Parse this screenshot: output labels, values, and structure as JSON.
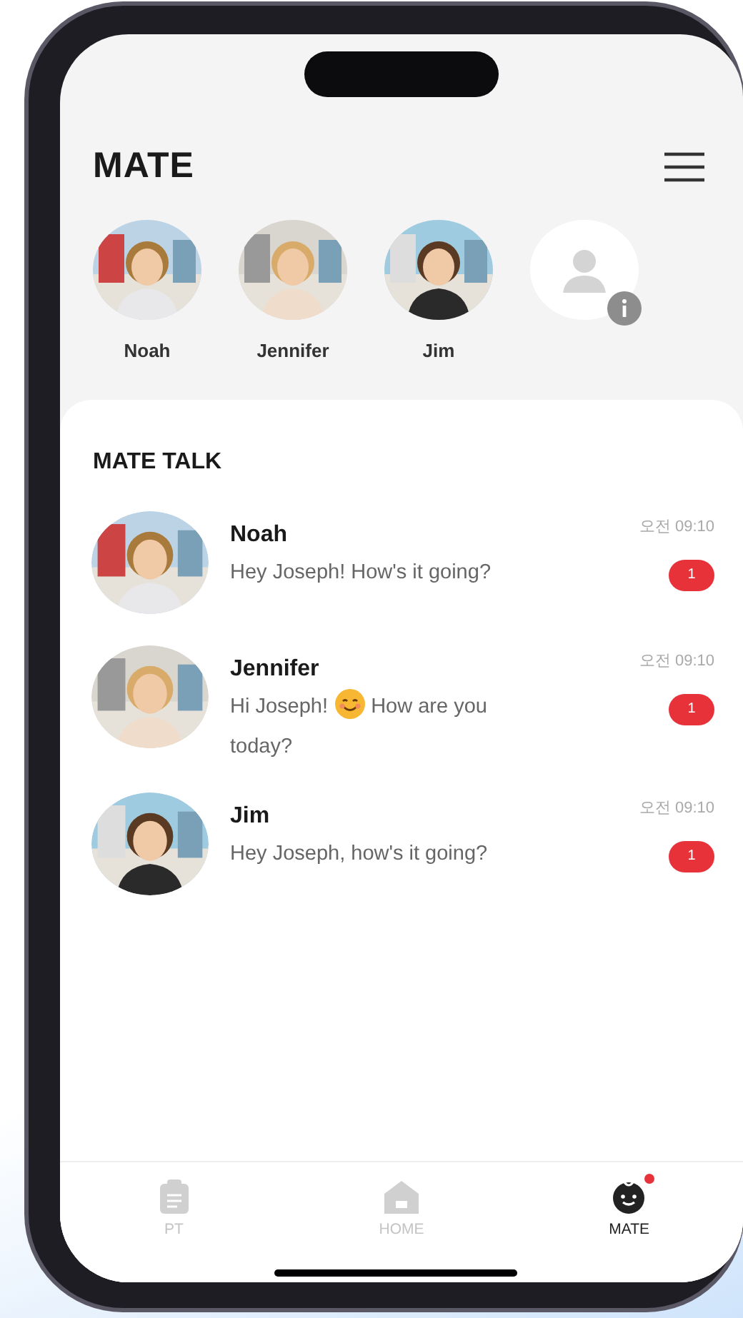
{
  "header": {
    "title": "MATE"
  },
  "mates": [
    {
      "name": "Noah"
    },
    {
      "name": "Jennifer"
    },
    {
      "name": "Jim"
    },
    {
      "kind": "placeholder"
    }
  ],
  "talk": {
    "title": "MATE TALK",
    "chats": [
      {
        "name": "Noah",
        "time": "오전 09:10",
        "unread": "1",
        "message": [
          {
            "kind": "text",
            "text": "Hey Joseph! How's it going?"
          }
        ]
      },
      {
        "name": "Jennifer",
        "time": "오전 09:10",
        "unread": "1",
        "message": [
          {
            "kind": "text",
            "text": "Hi Joseph!"
          },
          {
            "kind": "emoji"
          },
          {
            "kind": "text",
            "text": "How are you"
          },
          {
            "kind": "text",
            "text": "today?"
          }
        ]
      },
      {
        "name": "Jim",
        "time": "오전 09:10",
        "unread": "1",
        "message": [
          {
            "kind": "text",
            "text": "Hey Joseph, how's it going?"
          }
        ]
      }
    ]
  },
  "tabs": [
    {
      "kind": "clipboard",
      "label": "PT",
      "selected": false,
      "notification": false
    },
    {
      "kind": "home",
      "label": "HOME",
      "selected": false,
      "notification": false
    },
    {
      "kind": "face",
      "label": "MATE",
      "selected": true,
      "notification": true
    }
  ]
}
